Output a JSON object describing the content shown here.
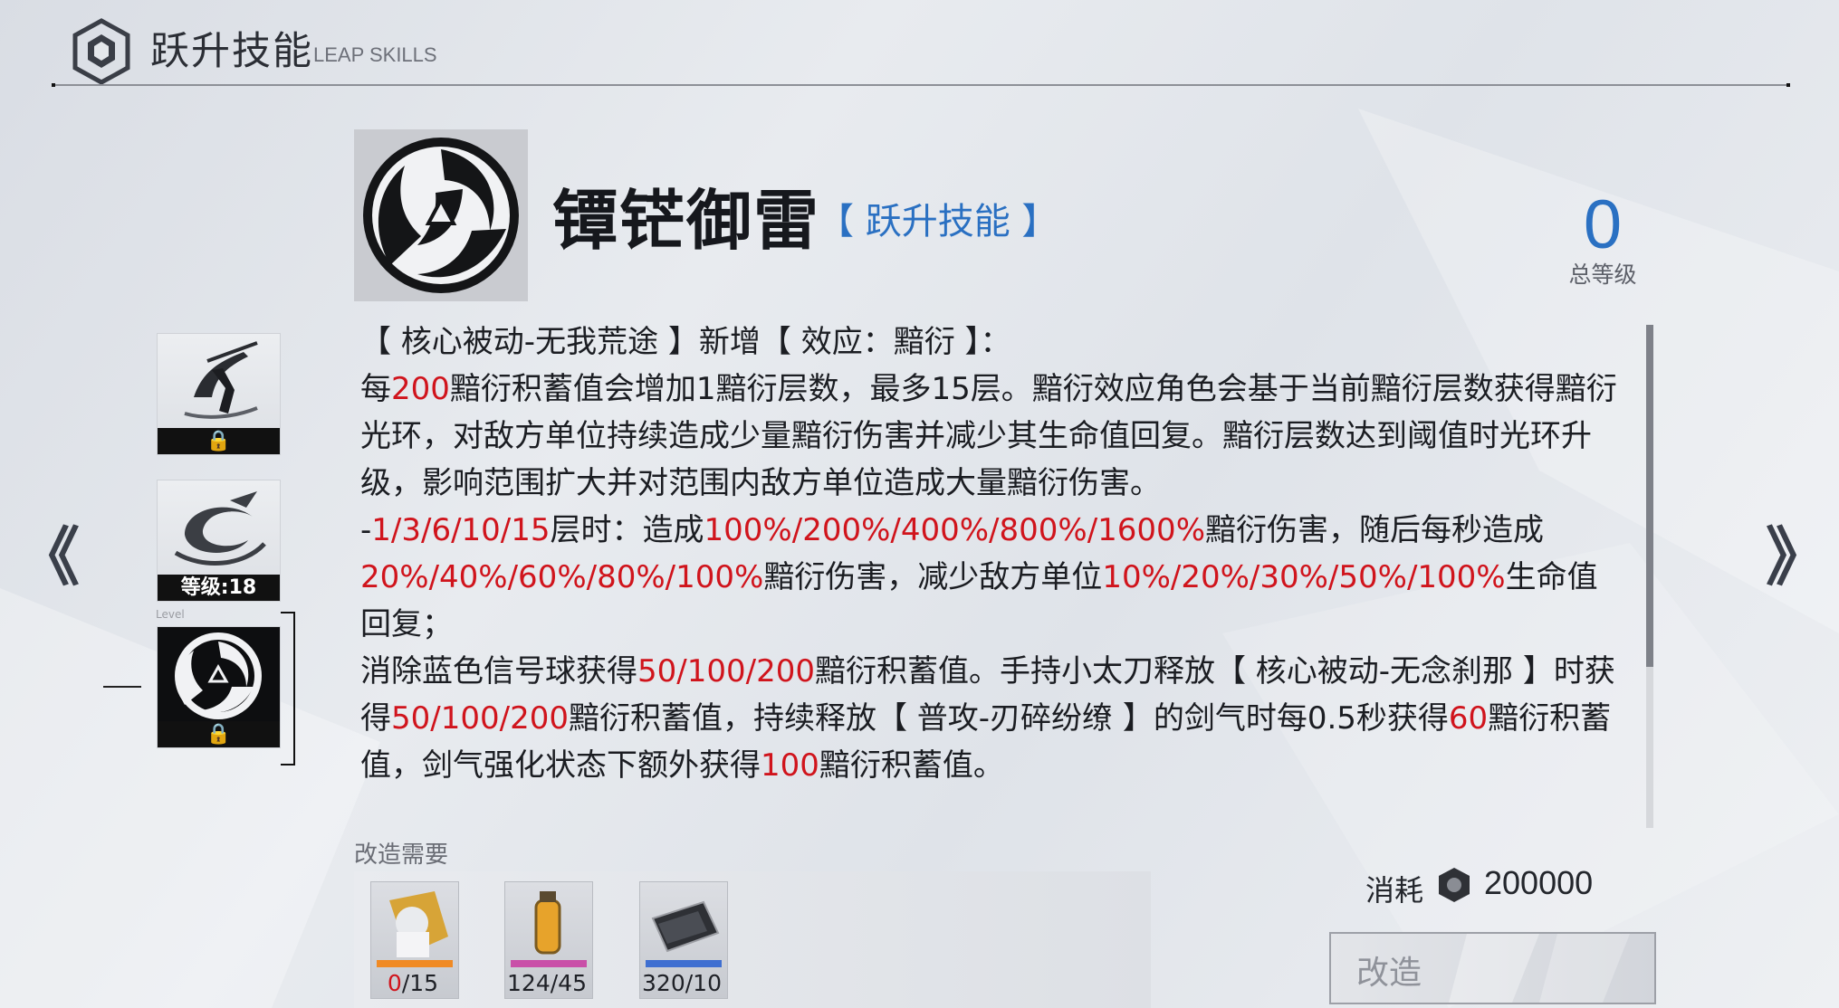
{
  "header": {
    "title": "跃升技能",
    "subtitle": "LEAP SKILLS"
  },
  "skill": {
    "name": "镡铓御雷",
    "tag": "【 跃升技能 】",
    "total_level": "0",
    "total_level_label": "总等级"
  },
  "description": [
    [
      {
        "t": "【 核心被动-无我荒途 】新增【 效应：黯衍 】："
      }
    ],
    [
      {
        "t": "每"
      },
      {
        "t": "200",
        "red": true
      },
      {
        "t": "黯衍积蓄值会增加1黯衍层数，最多15层。黯衍效应角色会基于当前黯衍层数获得黯衍光环，对敌方单位持续造成少量黯衍伤害并减少其生命值回复。黯衍层数达到阈值时光环升级，影响范围扩大并对范围内敌方单位造成大量黯衍伤害。"
      }
    ],
    [
      {
        "t": "-"
      },
      {
        "t": "1/3/6/10/15",
        "red": true
      },
      {
        "t": "层时：造成"
      },
      {
        "t": "100%/200%/400%/800%/1600%",
        "red": true
      },
      {
        "t": "黯衍伤害，随后每秒造成"
      },
      {
        "t": "20%/40%/60%/80%/100%",
        "red": true
      },
      {
        "t": "黯衍伤害，减少敌方单位"
      },
      {
        "t": "10%/20%/30%/50%/100%",
        "red": true
      },
      {
        "t": "生命值回复；"
      }
    ],
    [
      {
        "t": "消除蓝色信号球获得"
      },
      {
        "t": "50/100/200",
        "red": true
      },
      {
        "t": "黯衍积蓄值。手持小太刀释放【 核心被动-无念刹那 】时获得"
      },
      {
        "t": "50/100/200",
        "red": true
      },
      {
        "t": "黯衍积蓄值，持续释放【 普攻-刃碎纷缭 】的剑气时每0.5秒获得"
      },
      {
        "t": "60",
        "red": true
      },
      {
        "t": "黯衍积蓄值，剑气强化状态下额外获得"
      },
      {
        "t": "100",
        "red": true
      },
      {
        "t": "黯衍积蓄值。"
      }
    ]
  ],
  "skill_list": {
    "level_caption": "Level",
    "slots": [
      {
        "icon": "slash-figure-icon",
        "locked": true
      },
      {
        "icon": "swirl-icon",
        "level_text": "等级:18"
      },
      {
        "icon": "vortex-emblem-icon",
        "locked": true,
        "selected": true
      }
    ]
  },
  "nav": {
    "prev": "《",
    "next": "》"
  },
  "requirements": {
    "label": "改造需要",
    "materials": [
      {
        "icon": "character-shard-icon",
        "have": "0",
        "need": "/15",
        "insufficient": true
      },
      {
        "icon": "supply-vial-icon",
        "have": "124",
        "need": "/45"
      },
      {
        "icon": "sp-chip-icon",
        "have": "320",
        "need": "/10"
      }
    ],
    "cost_label": "消耗",
    "cost_icon": "hex-nut-icon",
    "cost_value": "200000",
    "button_label": "改造"
  },
  "colors": {
    "accent_blue": "#2a70c2",
    "highlight_red": "#d0141c"
  }
}
